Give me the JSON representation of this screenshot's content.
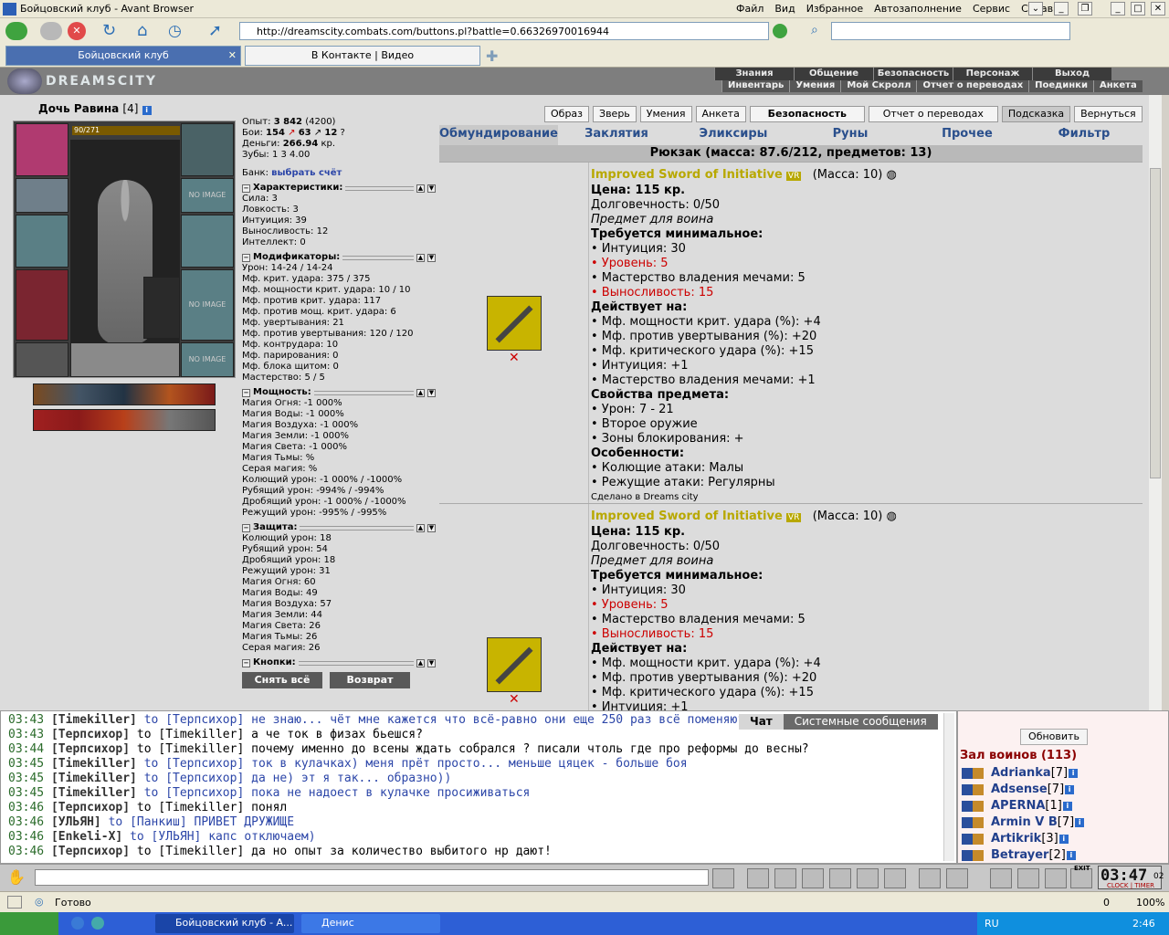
{
  "window": {
    "title": "Бойцовский клуб - Avant Browser",
    "menu": [
      "Файл",
      "Вид",
      "Избранное",
      "Автозаполнение",
      "Сервис",
      "Справка"
    ]
  },
  "toolbar": {
    "address": "http://dreamscity.combats.com/buttons.pl?battle=0.66326970016944"
  },
  "tabs": [
    {
      "label": "Бойцовский клуб"
    },
    {
      "label": "В Контакте | Видео"
    }
  ],
  "game": {
    "logo": "DREAMSCITY",
    "nav_row1": [
      "Знания",
      "Общение",
      "Безопасность",
      "Персонаж",
      "Выход"
    ],
    "nav_row2": [
      "Инвентарь",
      "Умения",
      "Мой Скролл",
      "Отчет о переводах",
      "Поединки",
      "Анкета"
    ]
  },
  "character": {
    "name": "Дочь Равина",
    "level": "[4]",
    "hp": "90/271",
    "exp_label": "Опыт:",
    "exp": "3 842",
    "exp_next": "(4200)",
    "fights_label": "Бои:",
    "fights_win": "154",
    "fights_loss": "63",
    "fights_draw": "12",
    "money_label": "Деньги:",
    "money": "266.94",
    "money_unit": "кр.",
    "teeth_label": "Зубы:",
    "teeth": "1  3  4.00",
    "bank_label": "Банк:",
    "bank_link": "выбрать счёт"
  },
  "sections": {
    "chars": {
      "title": "Характеристики:",
      "lines": [
        "Сила: 3",
        "Ловкость: 3",
        "Интуиция: 39",
        "Выносливость: 12",
        "Интеллект: 0"
      ]
    },
    "mods": {
      "title": "Модификаторы:",
      "lines": [
        "Урон: 14-24 / 14-24",
        "Мф. крит. удара: 375 / 375",
        "Мф. мощности крит. удара: 10 / 10",
        "Мф. против крит. удара: 117",
        "Мф. против мощ. крит. удара: 6",
        "Мф. увертывания: 21",
        "Мф. против увертывания: 120 / 120",
        "Мф. контрудара: 10",
        "Мф. парирования: 0",
        "Мф. блока щитом: 0",
        "Мастерство: 5 / 5"
      ]
    },
    "power": {
      "title": "Мощность:",
      "lines": [
        "Магия Огня: -1 000%",
        "Магия Воды: -1 000%",
        "Магия Воздуха: -1 000%",
        "Магия Земли: -1 000%",
        "Магия Света: -1 000%",
        "Магия Тьмы: %",
        "Серая магия: %",
        "Колющий урон: -1 000% / -1000%",
        "Рубящий урон: -994% / -994%",
        "Дробящий урон: -1 000% / -1000%",
        "Режущий урон: -995% / -995%"
      ]
    },
    "defense": {
      "title": "Защита:",
      "lines": [
        "Колющий урон: 18",
        "Рубящий урон: 54",
        "Дробящий урон: 18",
        "Режущий урон: 31",
        "Магия Огня: 60",
        "Магия Воды: 49",
        "Магия Воздуха: 57",
        "Магия Земли: 44",
        "Магия Света: 26",
        "Магия Тьмы: 26",
        "Серая магия: 26"
      ]
    },
    "buttons": {
      "title": "Кнопки:",
      "take_off": "Снять всё",
      "return": "Возврат"
    }
  },
  "panel_buttons": [
    "Образ",
    "Зверь",
    "Умения",
    "Анкета",
    "Безопасность",
    "Отчет о переводах",
    "Подсказка",
    "Вернуться"
  ],
  "cat_tabs": [
    "Обмундирование",
    "Заклятия",
    "Эликсиры",
    "Руны",
    "Прочее",
    "Фильтр"
  ],
  "bag_title": "Рюкзак (масса: 87.6/212, предметов: 13)",
  "items": [
    {
      "name": "Improved Sword of Initiative",
      "badge": "VR",
      "mass": "(Масса: 10)",
      "price": "Цена: 115 кр.",
      "durability": "Долговечность: 0/50",
      "for": "Предмет для воина",
      "req_title": "Требуется минимальное:",
      "req": [
        {
          "t": "• Интуиция: 30",
          "red": false
        },
        {
          "t": "• Уровень: 5",
          "red": true
        },
        {
          "t": "• Мастерство владения мечами: 5",
          "red": false
        },
        {
          "t": "• Выносливость: 15",
          "red": true
        }
      ],
      "acts_title": "Действует на:",
      "acts": [
        "• Мф. мощности крит. удара (%): +4",
        "• Мф. против увертывания (%): +20",
        "• Мф. критического удара (%): +15",
        "• Интуиция: +1",
        "• Мастерство владения мечами: +1"
      ],
      "props_title": "Свойства предмета:",
      "props": [
        "• Урон: 7 - 21",
        "• Второе оружие",
        "• Зоны блокирования: +"
      ],
      "feat_title": "Особенности:",
      "feats": [
        "• Колющие атаки: Малы",
        "• Режущие атаки: Регулярны"
      ],
      "made": "Сделано в Dreams city"
    },
    {
      "name": "Improved Sword of Initiative",
      "badge": "VR",
      "mass": "(Масса: 10)",
      "price": "Цена: 115 кр.",
      "durability": "Долговечность: 0/50",
      "for": "Предмет для воина",
      "req_title": "Требуется минимальное:",
      "req": [
        {
          "t": "• Интуиция: 30",
          "red": false
        },
        {
          "t": "• Уровень: 5",
          "red": true
        },
        {
          "t": "• Мастерство владения мечами: 5",
          "red": false
        },
        {
          "t": "• Выносливость: 15",
          "red": true
        }
      ],
      "acts_title": "Действует на:",
      "acts": [
        "• Мф. мощности крит. удара (%): +4",
        "• Мф. против увертывания (%): +20",
        "• Мф. критического удара (%): +15",
        "• Интуиция: +1"
      ]
    }
  ],
  "chat": {
    "tabs": [
      "Чат",
      "Системные сообщения"
    ],
    "lines": [
      {
        "time": "03:43",
        "from": "[Timekiller]",
        "to": "to [Терпсихор]",
        "msg": "не знаю... чёт мне кажется что всё-равно они еще 250 раз всё поменяют...",
        "blue": true
      },
      {
        "time": "03:43",
        "from": "[Терпсихор]",
        "to": "to [Timekiller]",
        "msg": "а че ток в физах бьешся?",
        "blue": false
      },
      {
        "time": "03:44",
        "from": "[Терпсихор]",
        "to": "to [Timekiller]",
        "msg": "почему именно до всены ждать собрался ? писали чтоль где про реформы до весны?",
        "blue": false
      },
      {
        "time": "03:45",
        "from": "[Timekiller]",
        "to": "to [Терпсихор]",
        "msg": "ток в кулачках) меня прёт просто... меньше цяцек - больше боя",
        "blue": true
      },
      {
        "time": "03:45",
        "from": "[Timekiller]",
        "to": "to [Терпсихор]",
        "msg": "да не) эт я так... образно))",
        "blue": true
      },
      {
        "time": "03:45",
        "from": "[Timekiller]",
        "to": "to [Терпсихор]",
        "msg": "пока не надоест в кулачке просиживаться",
        "blue": true
      },
      {
        "time": "03:46",
        "from": "[Терпсихор]",
        "to": "to [Timekiller]",
        "msg": "понял",
        "blue": false
      },
      {
        "time": "03:46",
        "from": "[УЛЬЯН]",
        "to": "to [Панкиш]",
        "msg": "ПРИВЕТ ДРУЖИЩЕ",
        "blue": true
      },
      {
        "time": "03:46",
        "from": "[Enkeli-X]",
        "to": "to [УЛЬЯН]",
        "msg": "капс отключаем)",
        "blue": true
      },
      {
        "time": "03:46",
        "from": "[Терпсихор]",
        "to": "to [Timekiller]",
        "msg": "да но опыт за количество выбитого нр дают!",
        "blue": false
      }
    ]
  },
  "users": {
    "refresh": "Обновить",
    "hall": "Зал воинов (113)",
    "list": [
      {
        "name": "Adrianka",
        "lvl": "[7]"
      },
      {
        "name": "Adsense",
        "lvl": "[7]"
      },
      {
        "name": "APERNA",
        "lvl": "[1]"
      },
      {
        "name": "Armin V B",
        "lvl": "[7]"
      },
      {
        "name": "Artikrik",
        "lvl": "[3]"
      },
      {
        "name": "Betrayer",
        "lvl": "[2]"
      }
    ]
  },
  "clock": {
    "time": "03:47",
    "sec": "02",
    "labels": "CLOCK | TIMER",
    "exit": "EXIT"
  },
  "status": {
    "text": "Готово",
    "counter": "0",
    "zoom": "100%"
  },
  "taskbar": {
    "items": [
      "Бойцовский клуб - A...",
      "Денис"
    ],
    "lang": "RU",
    "time": "2:46"
  }
}
